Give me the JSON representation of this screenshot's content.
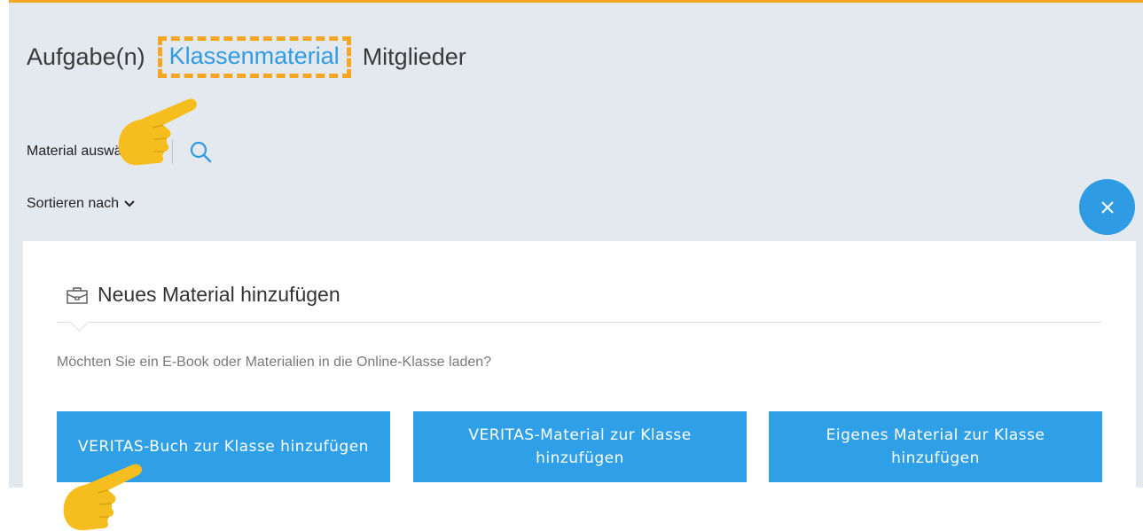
{
  "tabs": [
    {
      "label": "Aufgabe(n)",
      "active": false
    },
    {
      "label": "Klassenmaterial",
      "active": true
    },
    {
      "label": "Mitglieder",
      "active": false
    }
  ],
  "toolbar": {
    "material_label": "Material auswählen",
    "search_icon": "search-icon"
  },
  "sort": {
    "label": "Sortieren nach",
    "icon": "chevron-down-icon"
  },
  "close": {
    "icon": "close-icon"
  },
  "panel": {
    "icon": "briefcase-icon",
    "title": "Neues Material hinzufügen",
    "question": "Möchten Sie ein E-Book oder Materialien in die Online-Klasse laden?",
    "buttons": [
      {
        "label": "VERITAS-Buch zur Klasse hinzufügen"
      },
      {
        "label": "VERITAS-Material zur Klasse hinzufügen"
      },
      {
        "label": "Eigenes Material zur Klasse hinzufügen"
      }
    ]
  },
  "colors": {
    "accent": "#2f9be4",
    "highlight": "#f5a623",
    "pointer_hand": "#f5be1e",
    "background": "#e4e9ef"
  }
}
